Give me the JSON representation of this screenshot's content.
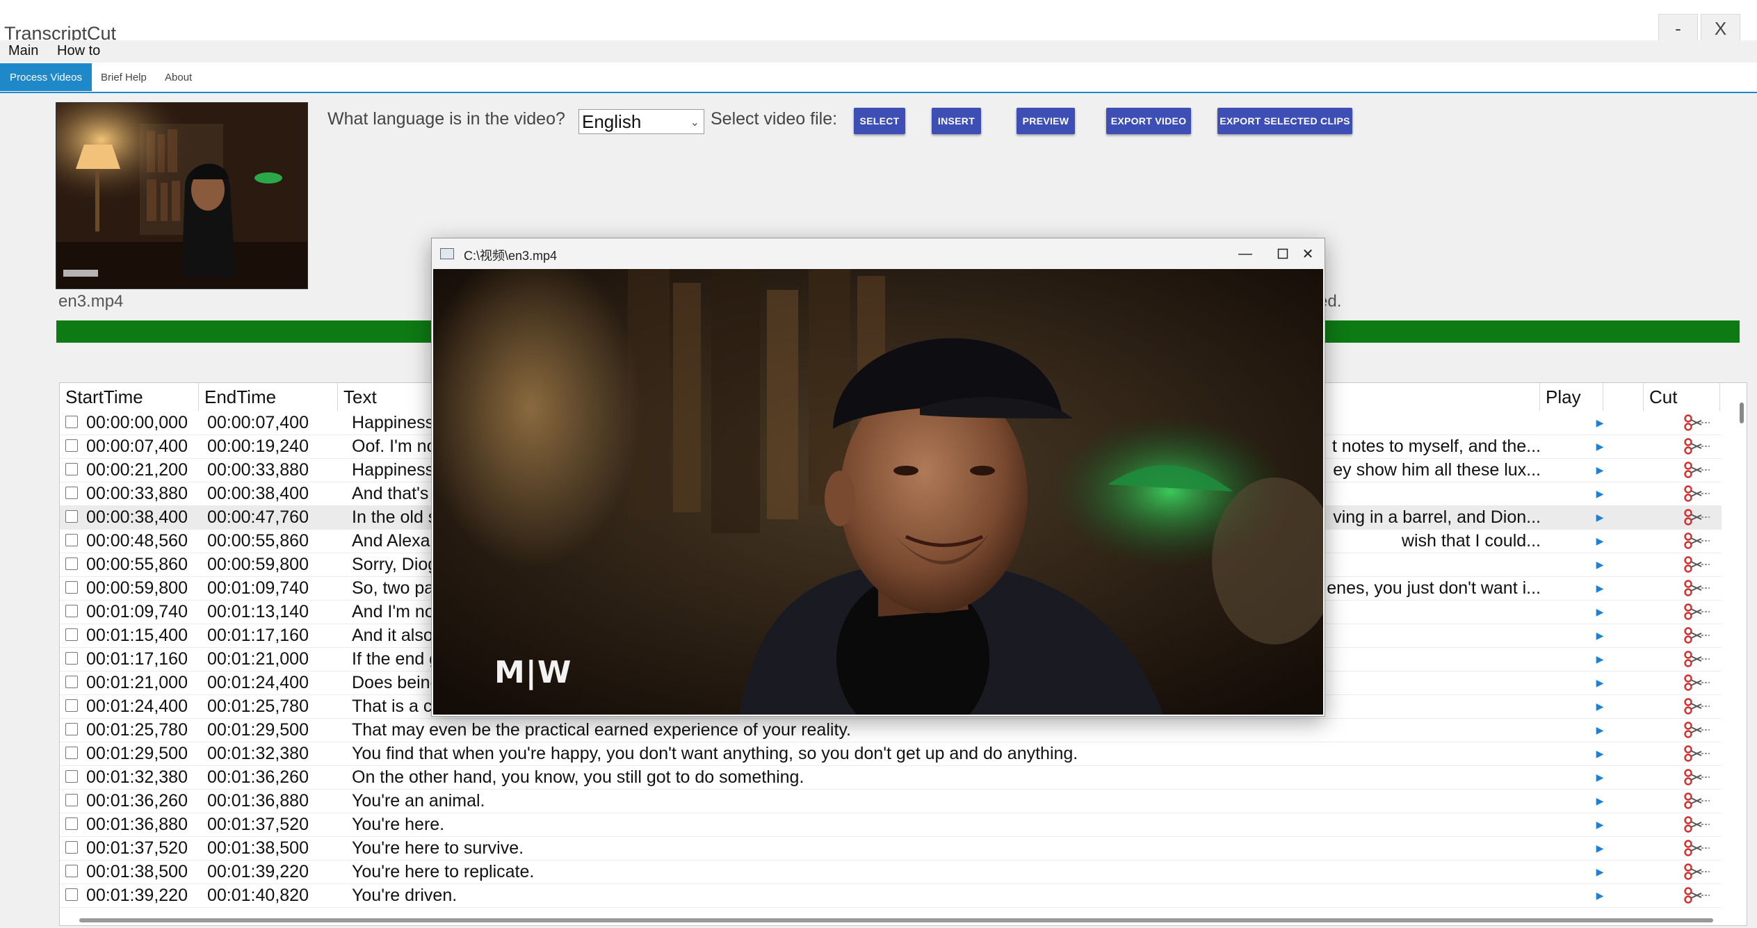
{
  "window": {
    "title": "TranscriptCut",
    "minimize_label": "-",
    "close_label": "X"
  },
  "menu": [
    "Main",
    "How to"
  ],
  "tabs": [
    {
      "label": "Process Videos",
      "active": true
    },
    {
      "label": "Brief Help",
      "active": false
    },
    {
      "label": "About",
      "active": false
    }
  ],
  "controls": {
    "language_label": "What language is in the video?",
    "language_value": "English",
    "select_file_label": "Select video file:",
    "buttons": [
      "SELECT",
      "INSERT",
      "PREVIEW",
      "EXPORT VIDEO",
      "EXPORT SELECTED CLIPS"
    ]
  },
  "file": {
    "name": "en3.mp4",
    "status_fragment": "ed."
  },
  "progress": 1.0,
  "colors": {
    "accent": "#3d4fb4",
    "tab_active": "#1e88c8",
    "progress": "#0e7a14",
    "play_icon": "#1e7fd6"
  },
  "table": {
    "headers": {
      "start": "StartTime",
      "end": "EndTime",
      "text": "Text",
      "play": "Play",
      "cut": "Cut"
    },
    "rows": [
      {
        "start": "00:00:00,000",
        "end": "00:00:07,400",
        "text": "Happiness",
        "right": ""
      },
      {
        "start": "00:00:07,400",
        "end": "00:00:19,240",
        "text": "Oof. I'm not",
        "right": "t notes to myself, and the..."
      },
      {
        "start": "00:00:21,200",
        "end": "00:00:33,880",
        "text": "Happiness,",
        "right": "ey show him all these lux..."
      },
      {
        "start": "00:00:33,880",
        "end": "00:00:38,400",
        "text": "And that's a",
        "right": ""
      },
      {
        "start": "00:00:38,400",
        "end": "00:00:47,760",
        "text": "In the old st",
        "right": "ving in a barrel, and Dion..."
      },
      {
        "start": "00:00:48,560",
        "end": "00:00:55,860",
        "text": "And Alexan",
        "right": "wish that I could..."
      },
      {
        "start": "00:00:55,860",
        "end": "00:00:59,800",
        "text": "Sorry, Diog",
        "right": ""
      },
      {
        "start": "00:00:59,800",
        "end": "00:01:09,740",
        "text": "So, two pat",
        "right": "enes, you just don't want i..."
      },
      {
        "start": "00:01:09,740",
        "end": "00:01:13,140",
        "text": "And I'm not",
        "right": ""
      },
      {
        "start": "00:01:15,400",
        "end": "00:01:17,160",
        "text": "And it also",
        "right": ""
      },
      {
        "start": "00:01:17,160",
        "end": "00:01:21,000",
        "text": "If the end g",
        "right": ""
      },
      {
        "start": "00:01:21,000",
        "end": "00:01:24,400",
        "text": "Does being",
        "right": ""
      },
      {
        "start": "00:01:24,400",
        "end": "00:01:25,780",
        "text": "That is a co",
        "right": ""
      },
      {
        "start": "00:01:25,780",
        "end": "00:01:29,500",
        "text": "That may even be the practical earned experience of your reality.",
        "right": ""
      },
      {
        "start": "00:01:29,500",
        "end": "00:01:32,380",
        "text": "You find that when you're happy, you don't want anything, so you don't get up and do anything.",
        "right": ""
      },
      {
        "start": "00:01:32,380",
        "end": "00:01:36,260",
        "text": "On the other hand, you know, you still got to do something.",
        "right": ""
      },
      {
        "start": "00:01:36,260",
        "end": "00:01:36,880",
        "text": "You're an animal.",
        "right": ""
      },
      {
        "start": "00:01:36,880",
        "end": "00:01:37,520",
        "text": "You're here.",
        "right": ""
      },
      {
        "start": "00:01:37,520",
        "end": "00:01:38,500",
        "text": "You're here to survive.",
        "right": ""
      },
      {
        "start": "00:01:38,500",
        "end": "00:01:39,220",
        "text": "You're here to replicate.",
        "right": ""
      },
      {
        "start": "00:01:39,220",
        "end": "00:01:40,820",
        "text": "You're driven.",
        "right": ""
      }
    ],
    "selected_row": 4
  },
  "video_window": {
    "title": "C:\\视频\\en3.mp4",
    "minimize_glyph": "—",
    "maximize_glyph": "☐",
    "close_glyph": "✕",
    "watermark": "M|W"
  }
}
